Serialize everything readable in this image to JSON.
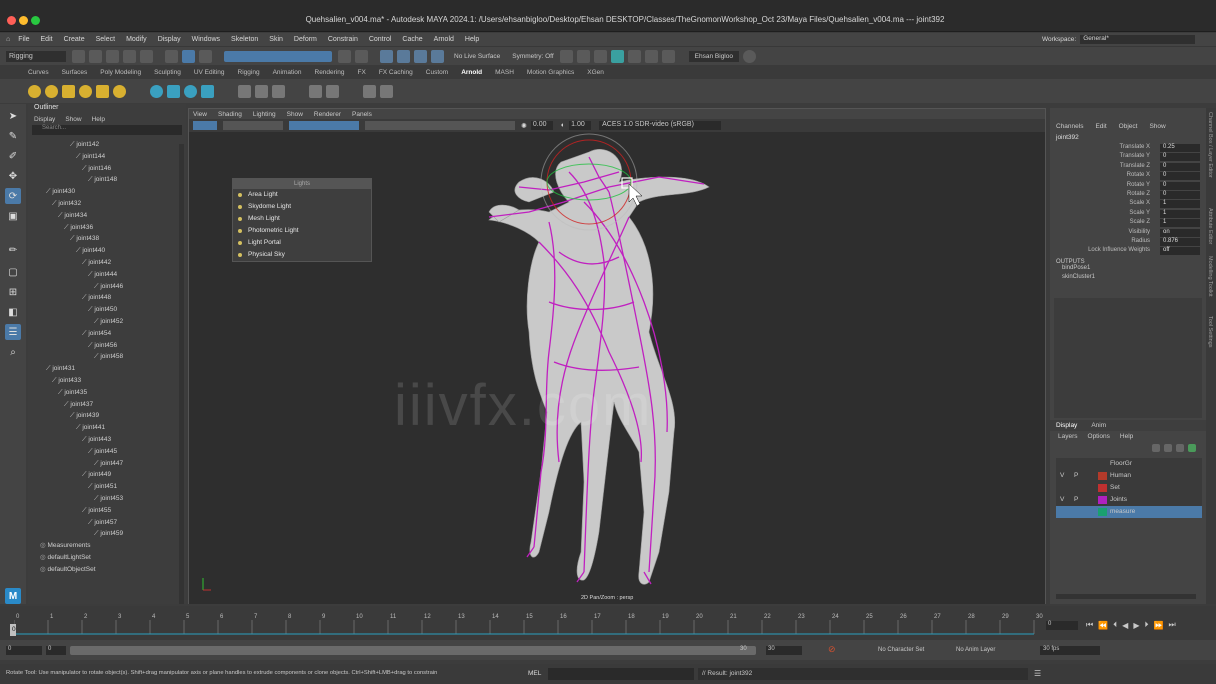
{
  "window": {
    "title": "Quehsalien_v004.ma* - Autodesk MAYA 2024.1: /Users/ehsanbigloo/Desktop/Ehsan DESKTOP/Classes/TheGnomonWorkshop_Oct 23/Maya Files/Quehsalien_v004.ma  ---  joint392"
  },
  "menubar": {
    "items": [
      "File",
      "Edit",
      "Create",
      "Select",
      "Modify",
      "Display",
      "Windows",
      "Skeleton",
      "Skin",
      "Deform",
      "Constrain",
      "Control",
      "Cache",
      "Arnold",
      "Help"
    ],
    "workspace_label": "Workspace:",
    "workspace_value": "General*"
  },
  "toolbar": {
    "mode": "Rigging",
    "live_surface": "No Live Surface",
    "symmetry": "Symmetry: Off",
    "user": "Ehsan Bigloo"
  },
  "shelf_tabs": [
    "Curves",
    "Surfaces",
    "Poly Modeling",
    "Sculpting",
    "UV Editing",
    "Rigging",
    "Animation",
    "Rendering",
    "FX",
    "FX Caching",
    "Custom",
    "Arnold",
    "MASH",
    "Motion Graphics",
    "XGen"
  ],
  "shelf_active": "Arnold",
  "outliner": {
    "title": "Outliner",
    "menu": [
      "Display",
      "Show",
      "Help"
    ],
    "search_placeholder": "Search...",
    "items": [
      {
        "name": "joint142",
        "depth": 5
      },
      {
        "name": "joint144",
        "depth": 6
      },
      {
        "name": "joint146",
        "depth": 7
      },
      {
        "name": "joint148",
        "depth": 8
      },
      {
        "name": "joint430",
        "depth": 1
      },
      {
        "name": "joint432",
        "depth": 2
      },
      {
        "name": "joint434",
        "depth": 3
      },
      {
        "name": "joint436",
        "depth": 4
      },
      {
        "name": "joint438",
        "depth": 5
      },
      {
        "name": "joint440",
        "depth": 6
      },
      {
        "name": "joint442",
        "depth": 7
      },
      {
        "name": "joint444",
        "depth": 8
      },
      {
        "name": "joint446",
        "depth": 9
      },
      {
        "name": "joint448",
        "depth": 7
      },
      {
        "name": "joint450",
        "depth": 8
      },
      {
        "name": "joint452",
        "depth": 9
      },
      {
        "name": "joint454",
        "depth": 7
      },
      {
        "name": "joint456",
        "depth": 8
      },
      {
        "name": "joint458",
        "depth": 9
      },
      {
        "name": "joint431",
        "depth": 1
      },
      {
        "name": "joint433",
        "depth": 2
      },
      {
        "name": "joint435",
        "depth": 3
      },
      {
        "name": "joint437",
        "depth": 4
      },
      {
        "name": "joint439",
        "depth": 5
      },
      {
        "name": "joint441",
        "depth": 6
      },
      {
        "name": "joint443",
        "depth": 7
      },
      {
        "name": "joint445",
        "depth": 8
      },
      {
        "name": "joint447",
        "depth": 9
      },
      {
        "name": "joint449",
        "depth": 7
      },
      {
        "name": "joint451",
        "depth": 8
      },
      {
        "name": "joint453",
        "depth": 9
      },
      {
        "name": "joint455",
        "depth": 7
      },
      {
        "name": "joint457",
        "depth": 8
      },
      {
        "name": "joint459",
        "depth": 9
      },
      {
        "name": "Measurements",
        "depth": 0
      },
      {
        "name": "defaultLightSet",
        "depth": 0
      },
      {
        "name": "defaultObjectSet",
        "depth": 0
      }
    ]
  },
  "viewport": {
    "menu": [
      "View",
      "Shading",
      "Lighting",
      "Show",
      "Renderer",
      "Panels"
    ],
    "exposure": "0.00",
    "gamma": "1.00",
    "color_space": "ACES 1.0 SDR-video (sRGB)",
    "hud_label": "2D Pan/Zoom : persp",
    "watermark": "iiivfx.com"
  },
  "lights_menu": {
    "title": "Lights",
    "items": [
      "Area Light",
      "Skydome Light",
      "Mesh Light",
      "Photometric Light",
      "Light Portal",
      "Physical Sky"
    ]
  },
  "channel_box": {
    "menu": [
      "Channels",
      "Edit",
      "Object",
      "Show"
    ],
    "object": "joint392",
    "attributes": [
      {
        "name": "Translate X",
        "value": "0.25"
      },
      {
        "name": "Translate Y",
        "value": "0"
      },
      {
        "name": "Translate Z",
        "value": "0"
      },
      {
        "name": "Rotate X",
        "value": "0"
      },
      {
        "name": "Rotate Y",
        "value": "0"
      },
      {
        "name": "Rotate Z",
        "value": "0"
      },
      {
        "name": "Scale X",
        "value": "1"
      },
      {
        "name": "Scale Y",
        "value": "1"
      },
      {
        "name": "Scale Z",
        "value": "1"
      },
      {
        "name": "Visibility",
        "value": "on"
      },
      {
        "name": "Radius",
        "value": "0.876"
      },
      {
        "name": "Lock Influence Weights",
        "value": "off"
      }
    ],
    "outputs_label": "OUTPUTS",
    "outputs": [
      "bindPose1",
      "skinCluster1"
    ]
  },
  "layer_editor": {
    "tabs": [
      "Display",
      "Anim"
    ],
    "menu": [
      "Layers",
      "Options",
      "Help"
    ],
    "layers": [
      {
        "v": "",
        "p": "",
        "color": "#3a3a3a",
        "name": "FloorGr"
      },
      {
        "v": "V",
        "p": "P",
        "color": "#b33a2a",
        "name": "Human"
      },
      {
        "v": "",
        "p": "",
        "color": "#c03030",
        "name": "Set"
      },
      {
        "v": "V",
        "p": "P",
        "color": "#b020c0",
        "name": "Joints"
      },
      {
        "v": "",
        "p": "",
        "color": "#1aa070",
        "name": "measure"
      }
    ]
  },
  "side_strip": [
    "Channel Box / Layer Editor",
    "Attribute Editor",
    "Modelling Toolkit",
    "Tool Settings"
  ],
  "timeline": {
    "ticks": [
      "0",
      "1",
      "2",
      "3",
      "4",
      "5",
      "6",
      "7",
      "8",
      "9",
      "10",
      "11",
      "12",
      "13",
      "14",
      "15",
      "16",
      "17",
      "18",
      "19",
      "20",
      "21",
      "22",
      "23",
      "24",
      "25",
      "26",
      "27",
      "28",
      "29",
      "30"
    ],
    "current": "0"
  },
  "range": {
    "start": "0",
    "start_inner": "0",
    "end_inner": "30",
    "end": "30",
    "character_set": "No Character Set",
    "anim_layer": "No Anim Layer",
    "fps": "30 fps"
  },
  "status": {
    "help": "Rotate Tool: Use manipulator to rotate object(s). Shift+drag manipulator axis or plane handles to extrude components or clone objects. Ctrl+Shift+LMB+drag to constrain",
    "script_type": "MEL",
    "result": "// Result: joint392"
  },
  "colors": {
    "joint_magenta": "#c020c0",
    "mesh_gray": "#c8c8c8",
    "selection_blue": "#4b7aa8"
  }
}
